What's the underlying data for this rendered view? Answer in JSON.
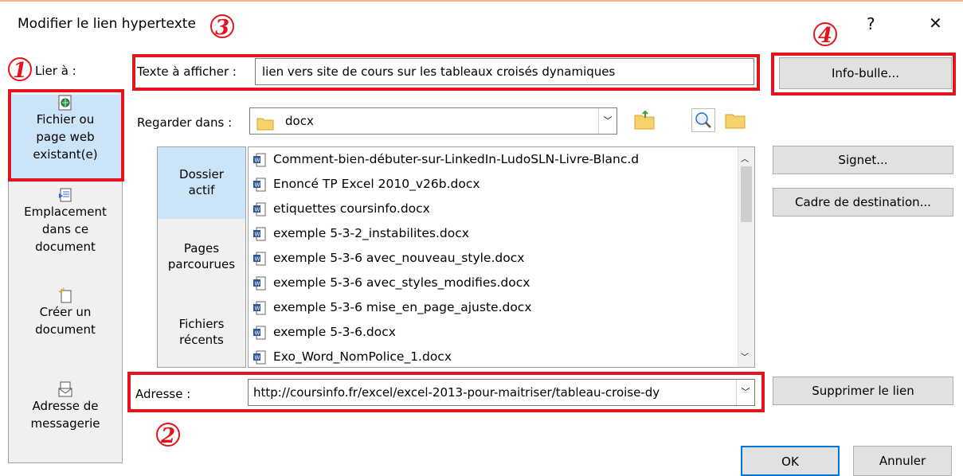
{
  "window": {
    "title": "Modifier le lien hypertexte",
    "help_label": "?",
    "close_label": "✕"
  },
  "annotations": [
    "1",
    "2",
    "3",
    "4"
  ],
  "link_to": {
    "label": "Lier à :",
    "items": [
      {
        "line1": "Fichier ou",
        "line2": "page web",
        "line3": "existant(e)",
        "icon": "web-file-icon"
      },
      {
        "line1": "Emplacement",
        "line2": "dans ce",
        "line3": "document",
        "icon": "place-in-document-icon"
      },
      {
        "line1": "Créer un",
        "line2": "document",
        "line3": "",
        "icon": "new-document-icon"
      },
      {
        "line1": "Adresse de",
        "line2": "messagerie",
        "line3": "",
        "icon": "email-icon"
      }
    ]
  },
  "text_to_display": {
    "label": "Texte à afficher :",
    "value": "lien vers site de cours sur les tableaux croisés dynamiques"
  },
  "screen_tip_button": "Info-bulle...",
  "look_in": {
    "label": "Regarder dans :",
    "value": "docx"
  },
  "places": [
    {
      "line1": "Dossier",
      "line2": "actif"
    },
    {
      "line1": "Pages",
      "line2": "parcourues"
    },
    {
      "line1": "Fichiers",
      "line2": "récents"
    }
  ],
  "files": [
    "Comment-bien-débuter-sur-LinkedIn-LudoSLN-Livre-Blanc.d",
    "Enoncé TP Excel 2010_v26b.docx",
    "etiquettes coursinfo.docx",
    "exemple 5-3-2_instabilites.docx",
    "exemple 5-3-6 avec_nouveau_style.docx",
    "exemple 5-3-6 avec_styles_modifies.docx",
    "exemple 5-3-6 mise_en_page_ajuste.docx",
    "exemple 5-3-6.docx",
    "Exo_Word_NomPolice_1.docx"
  ],
  "buttons": {
    "bookmark": "Signet...",
    "target_frame": "Cadre de destination...",
    "remove_link": "Supprimer le lien",
    "ok": "OK",
    "cancel": "Annuler"
  },
  "address": {
    "label": "Adresse :",
    "value": "http://coursinfo.fr/excel/excel-2013-pour-maitriser/tableau-croise-dy"
  },
  "colors": {
    "annotation_red": "#e3141b",
    "selected_nav": "#cce4f7",
    "ok_border": "#0078d7"
  }
}
